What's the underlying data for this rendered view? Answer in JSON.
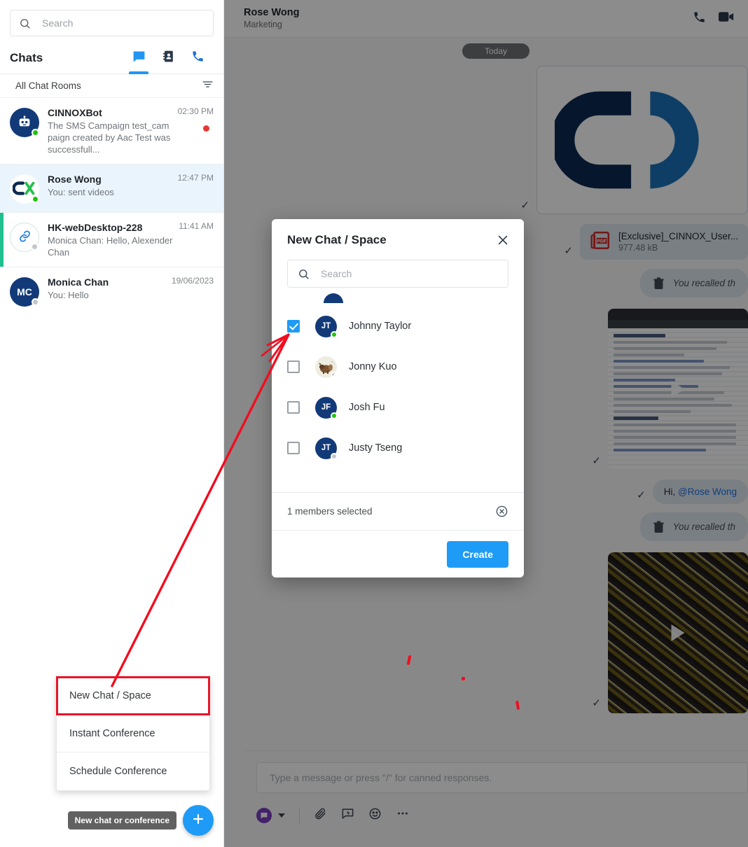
{
  "sidebar": {
    "search": {
      "placeholder": "Search",
      "value": "",
      "icon": "search-icon"
    },
    "header": {
      "title": "Chats"
    },
    "tabs": [
      {
        "name": "chats",
        "icon": "chat-bubble-icon",
        "active": true
      },
      {
        "name": "contacts",
        "icon": "contacts-book-icon",
        "active": false
      },
      {
        "name": "calls",
        "icon": "phone-icon",
        "active": false
      }
    ],
    "section": {
      "label": "All Chat Rooms",
      "filter_icon": "filter-icon"
    },
    "chats": [
      {
        "name": "CINNOXBot",
        "preview": "The SMS Campaign test_campaign created by Aac Test was successfull...",
        "time": "02:30 PM",
        "avatar_type": "bot",
        "avatar_initials": "",
        "avatar_color": "#123a78",
        "presence": "online",
        "unread": true,
        "selected": false,
        "accent": ""
      },
      {
        "name": "Rose Wong",
        "preview": "You:  sent videos",
        "time": "12:47 PM",
        "avatar_type": "cinnox-logo",
        "avatar_initials": "",
        "avatar_color": "#ffffff",
        "presence": "online",
        "unread": false,
        "selected": true,
        "accent": ""
      },
      {
        "name": "HK-webDesktop-228",
        "preview": "Monica Chan: Hello, Alexender Chan",
        "time": "11:41 AM",
        "avatar_type": "link",
        "avatar_initials": "",
        "avatar_color": "#ffffff",
        "presence": "offline",
        "unread": false,
        "selected": false,
        "accent": "#1fbf8f"
      },
      {
        "name": "Monica Chan",
        "preview": "You: Hello",
        "time": "19/06/2023",
        "avatar_type": "initials",
        "avatar_initials": "MC",
        "avatar_color": "#123a78",
        "presence": "offline",
        "unread": false,
        "selected": false,
        "accent": ""
      }
    ],
    "fab": {
      "tooltip": "New chat or conference",
      "icon": "plus-icon"
    },
    "popup_menu": {
      "items": [
        {
          "label": "New Chat / Space",
          "highlighted": true
        },
        {
          "label": "Instant Conference",
          "highlighted": false
        },
        {
          "label": "Schedule Conference",
          "highlighted": false
        }
      ]
    }
  },
  "chat_header": {
    "title": "Rose Wong",
    "subtitle": "Marketing",
    "icons": [
      {
        "name": "phone-call-icon"
      },
      {
        "name": "video-call-icon"
      }
    ]
  },
  "conversation": {
    "day_divider": "Today",
    "messages": [
      {
        "type": "image",
        "kind": "cinnox-logo",
        "status": "sent"
      },
      {
        "type": "file",
        "filename": "[Exclusive]_CINNOX_User...",
        "filesize": "977.48 kB",
        "icon": "pdf-icon",
        "status": "sent"
      },
      {
        "type": "recalled",
        "text": "You recalled th",
        "icon": "trash-icon"
      },
      {
        "type": "video",
        "kind": "browser-screenshot",
        "status": "sent"
      },
      {
        "type": "text",
        "prefix": "Hi, ",
        "mention": "@Rose Wong",
        "status": "sent"
      },
      {
        "type": "recalled",
        "text": "You recalled th",
        "icon": "trash-icon"
      },
      {
        "type": "video",
        "kind": "carpet",
        "status": "sent"
      }
    ]
  },
  "composer": {
    "placeholder": "Type a message or press \"/\" for canned responses.",
    "value": "",
    "channel_icon": "chat-channel-icon",
    "tools": [
      {
        "name": "attachment-icon"
      },
      {
        "name": "canned-response-icon"
      },
      {
        "name": "emoji-icon"
      },
      {
        "name": "more-options-icon"
      }
    ]
  },
  "modal": {
    "title": "New Chat / Space",
    "close_icon": "close-icon",
    "search": {
      "placeholder": "Search",
      "value": "",
      "icon": "search-icon"
    },
    "members": [
      {
        "name": "Johnny Taylor",
        "initials": "JT",
        "avatar_color": "#123a78",
        "avatar_type": "initials",
        "presence": "online",
        "checked": true
      },
      {
        "name": "Jonny Kuo",
        "initials": "",
        "avatar_color": "#eceade",
        "avatar_type": "photo",
        "presence": "offline",
        "checked": false
      },
      {
        "name": "Josh Fu",
        "initials": "JF",
        "avatar_color": "#123a78",
        "avatar_type": "initials",
        "presence": "online",
        "checked": false
      },
      {
        "name": "Justy Tseng",
        "initials": "JT",
        "avatar_color": "#123a78",
        "avatar_type": "initials",
        "presence": "offline",
        "checked": false
      }
    ],
    "footer": {
      "selected_text": "1 members selected",
      "clear_icon": "clear-circle-icon"
    },
    "create_label": "Create"
  },
  "colors": {
    "accent_blue": "#1d9bf6",
    "annotation_red": "#e8152a",
    "presence_online": "#20c40d",
    "brand_navy": "#123a78",
    "unread_red": "#e53935"
  }
}
